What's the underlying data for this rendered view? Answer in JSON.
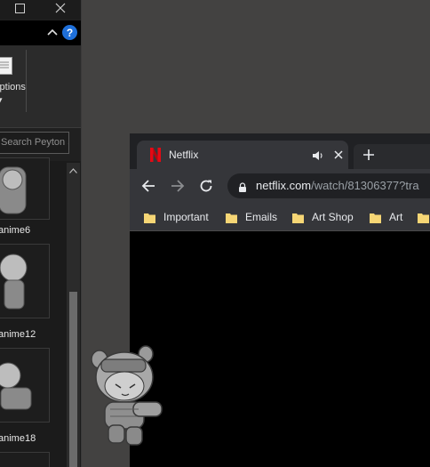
{
  "explorer": {
    "ribbon_label": "Options",
    "search_placeholder": "Search Peyton Spac...",
    "files": [
      {
        "name": "anime6"
      },
      {
        "name": "anime12"
      },
      {
        "name": "anime18"
      }
    ]
  },
  "browser": {
    "tab": {
      "title": "Netflix"
    },
    "url": {
      "domain": "netflix.com",
      "path": "/watch/81306377?tra"
    },
    "bookmarks": [
      {
        "label": "Important"
      },
      {
        "label": "Emails"
      },
      {
        "label": "Art Shop"
      },
      {
        "label": "Art"
      }
    ]
  },
  "colors": {
    "desktop": "#434241",
    "explorer_bg": "#202020",
    "browser_frame": "#35363a",
    "netflix_red": "#e50914",
    "help_blue": "#1e6fd9",
    "folder_yellow": "#f6d675"
  }
}
